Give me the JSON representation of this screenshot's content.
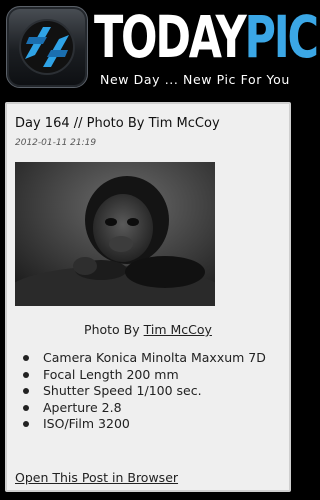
{
  "header": {
    "brand_left": "TODAY",
    "brand_right": "PIC",
    "tagline": "New Day ... New Pic For You",
    "accent_color": "#3ba7e6",
    "logo_icon": "aperture-icon"
  },
  "post": {
    "title": "Day 164 // Photo By Tim McCoy",
    "date": "2012-01-11 21:19",
    "image_icon": "gorilla-photo",
    "caption_prefix": "Photo By ",
    "photographer": "Tim McCoy",
    "exif": [
      "Camera Konica Minolta Maxxum 7D",
      "Focal Length 200 mm",
      "Shutter Speed 1/100 sec.",
      "Aperture 2.8",
      "ISO/Film 3200"
    ],
    "open_link": "Open This Post in Browser"
  }
}
